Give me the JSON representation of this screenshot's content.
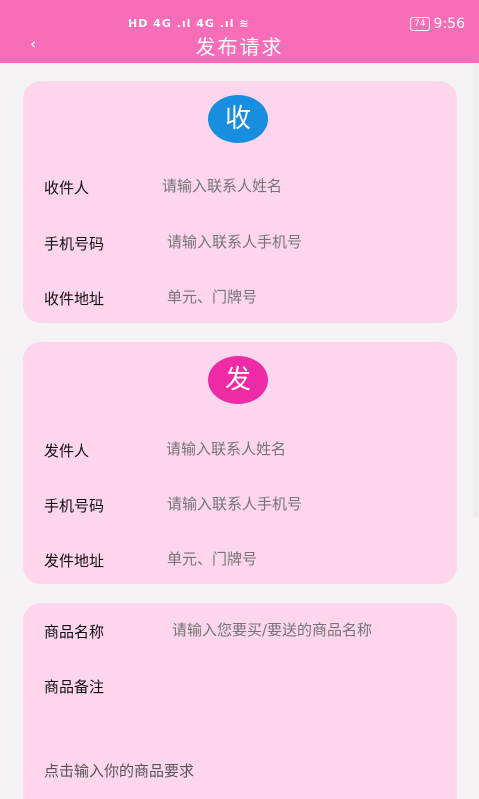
{
  "status_bar": {
    "icons_text": "HD 4G .ıl 4G .ıl ≋",
    "battery": "74",
    "time": "9:56"
  },
  "header": {
    "back": "‹",
    "title": "发布请求"
  },
  "receive": {
    "badge": "收",
    "rows": [
      {
        "label": "收件人",
        "placeholder": "请输入联系人姓名"
      },
      {
        "label": "手机号码",
        "placeholder": "请输入联系人手机号"
      },
      {
        "label": "收件地址",
        "placeholder": "单元、门牌号"
      }
    ]
  },
  "send": {
    "badge": "发",
    "rows": [
      {
        "label": "发件人",
        "placeholder": "请输入联系人姓名"
      },
      {
        "label": "手机号码",
        "placeholder": "请输入联系人手机号"
      },
      {
        "label": "发件地址",
        "placeholder": "单元、门牌号"
      }
    ]
  },
  "goods": {
    "name_label": "商品名称",
    "name_placeholder": "请输入您要买/要送的商品名称",
    "note_label": "商品备注",
    "note_hint": "点击输入你的商品要求"
  },
  "colors": {
    "header": "#f76db8",
    "card": "#fdd5ec",
    "badge_receive": "#178ee0",
    "badge_send": "#ee2aa7"
  }
}
